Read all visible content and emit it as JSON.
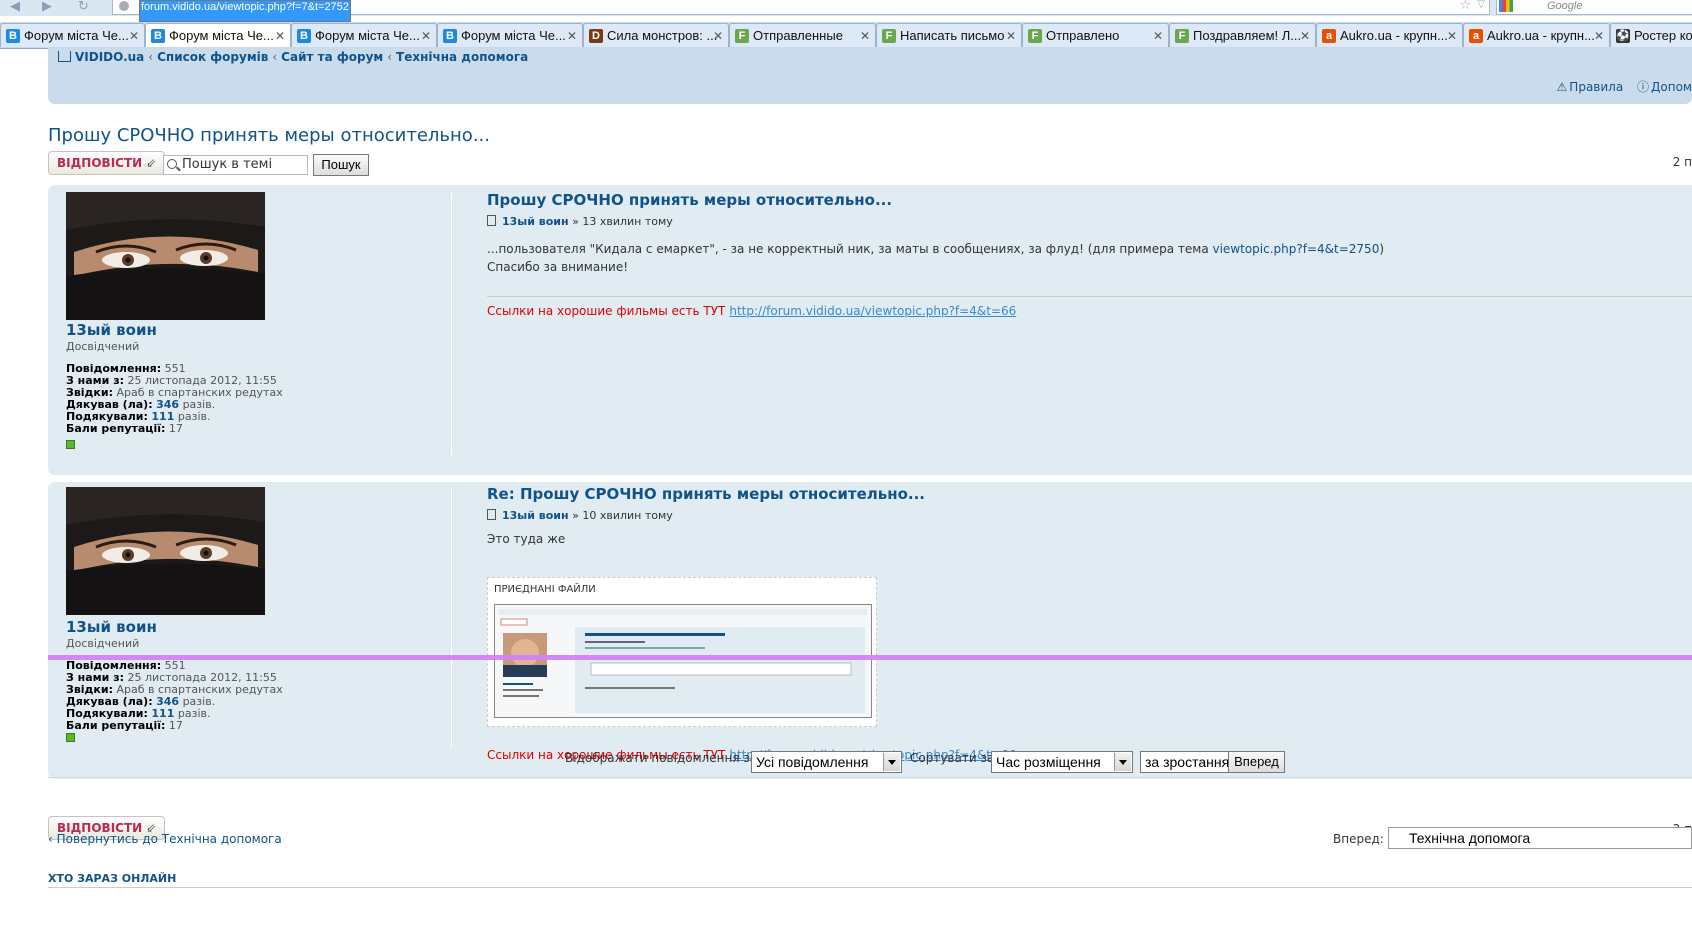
{
  "browser": {
    "url": "forum.vidido.ua/viewtopic.php?f=7&t=2752",
    "search_placeholder": "Google",
    "tabs": [
      {
        "label": "Форум міста Че...",
        "icon": "B",
        "color": "#1e88e5"
      },
      {
        "label": "Форум міста Че...",
        "icon": "B",
        "color": "#1e88e5"
      },
      {
        "label": "Форум міста Че...",
        "icon": "B",
        "color": "#1e88e5"
      },
      {
        "label": "Форум міста Че...",
        "icon": "B",
        "color": "#1e88e5"
      },
      {
        "label": "Сила монстров: ...",
        "icon": "D",
        "color": "#7a3b12"
      },
      {
        "label": "Отправленные",
        "icon": "F",
        "color": "#6aa84f"
      },
      {
        "label": "Написать письмо",
        "icon": "F",
        "color": "#6aa84f"
      },
      {
        "label": "Отправлено",
        "icon": "F",
        "color": "#6aa84f"
      },
      {
        "label": "Поздравляем! Л...",
        "icon": "F",
        "color": "#6aa84f"
      },
      {
        "label": "Aukro.ua - крупн...",
        "icon": "a",
        "color": "#e65100"
      },
      {
        "label": "Aukro.ua - крупн...",
        "icon": "a",
        "color": "#e65100"
      },
      {
        "label": "Ростер кома",
        "icon": "⚽",
        "color": "#333333"
      }
    ]
  },
  "breadcrumb": [
    "VIDIDO.ua",
    "Список форумів",
    "Сайт та форум",
    "Технічна допомога"
  ],
  "nav_links": {
    "rules": "Правила",
    "help": "Допом"
  },
  "topic": {
    "title": "Прошу СРОЧНО принять меры относительно...",
    "reply_label": "ВІДПОВІСТИ",
    "search_placeholder": "Пошук в темі",
    "search_button": "Пошук",
    "page_count": "2 п"
  },
  "posts": [
    {
      "title": "Прошу СРОЧНО принять меры относительно...",
      "author": "13ый воин",
      "time": "13 хвилин тому",
      "body_line1": "...пользователя \"Кидала с емаркет\", - за не корректный ник, за маты в сообщениях, за флуд! (для примера тема ",
      "body_link": "viewtopic.php?f=4&t=2750",
      "body_line1_end": ")",
      "body_line2": "Спасибо за внимание!",
      "signature": "Ссылки на хорошие фильмы есть ТУТ",
      "signature_link": "http://forum.vidido.ua/viewtopic.php?f=4&t=66"
    },
    {
      "title": "Re: Прошу СРОЧНО принять меры относительно...",
      "author": "13ый воин",
      "time": "10 хвилин тому",
      "body": "Это туда же",
      "attachments_label": "ПРИЄДНАНІ ФАЙЛИ",
      "signature": "Ссылки на хорошие фильмы есть ТУТ",
      "signature_link": "http://forum.vidido.ua/viewtopic.php?f=4&t=66"
    }
  ],
  "profile": {
    "name": "13ый воин",
    "rank": "Досвідчений",
    "posts_label": "Повідомлення:",
    "posts": "551",
    "joined_label": "З нами з:",
    "joined": "25 листопада 2012, 11:55",
    "from_label": "Звідки:",
    "from": "Араб в спартанских редутах",
    "thanked_label": "Дякував (ла):",
    "thanked": "346",
    "thanked_suffix": "разів.",
    "thanks_label": "Подякували:",
    "thanks": "111",
    "thanks_suffix": "разів.",
    "rep_label": "Бали репутації:",
    "rep": "17"
  },
  "sorting": {
    "display_label": "Відображати повідомлення за:",
    "display_value": "Усі повідомлення",
    "sort_label": "Сортувати за",
    "sort_value": "Час розміщення",
    "order_value": "за зростанням",
    "go_button": "Вперед"
  },
  "footer": {
    "back_link": "Повернутись до Технічна допомога",
    "jump_label": "Вперед:",
    "jump_value": "Технічна допомога",
    "who_online": "ХТО ЗАРАЗ ОНЛАЙН"
  }
}
